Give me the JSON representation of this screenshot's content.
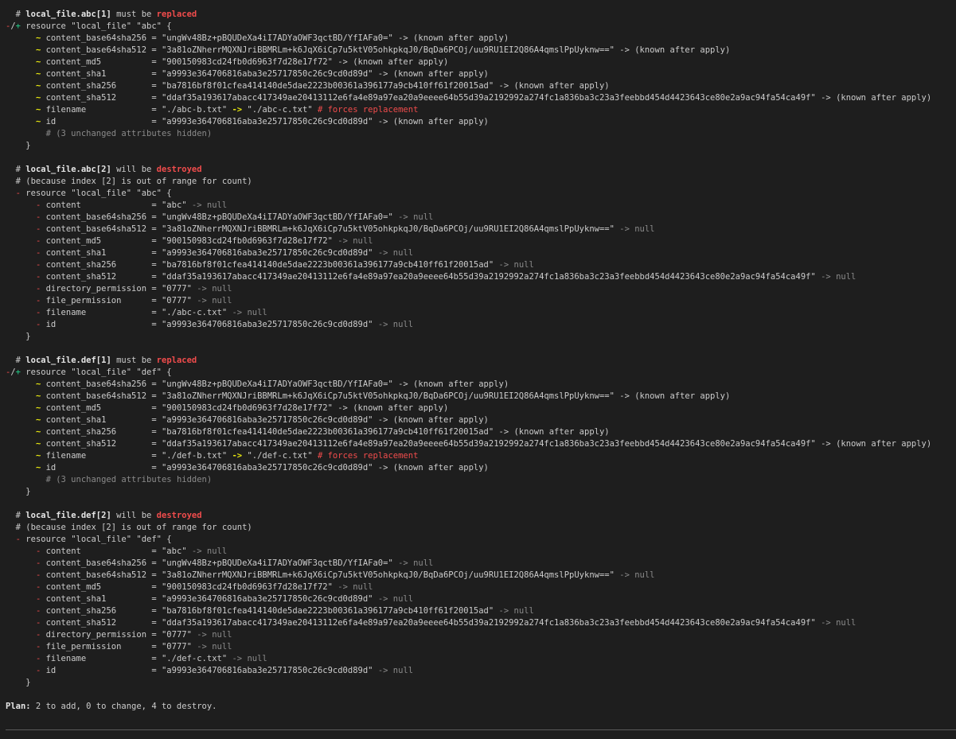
{
  "colors": {
    "background": "#1e1e1e",
    "text": "#cccccc",
    "red": "#f14c4c",
    "yellow": "#e5e510",
    "green": "#23d18b",
    "dim": "#8a8a8a"
  },
  "lines": [
    [
      {
        "t": "  # "
      },
      {
        "t": "local_file.abc[1]",
        "c": "b"
      },
      {
        "t": " must be "
      },
      {
        "t": "replaced",
        "c": "red"
      }
    ],
    [
      {
        "t": "-",
        "c": "red-plain"
      },
      {
        "t": "/",
        "c": ""
      },
      {
        "t": "+",
        "c": "grn"
      },
      {
        "t": " resource \"local_file\" \"abc\" {"
      }
    ],
    [
      {
        "t": "      "
      },
      {
        "t": "~",
        "c": "yel"
      },
      {
        "t": " content_base64sha256 = \"ungWv48Bz+pBQUDeXa4iI7ADYaOWF3qctBD/YfIAFa0=\" -> (known after apply)"
      }
    ],
    [
      {
        "t": "      "
      },
      {
        "t": "~",
        "c": "yel"
      },
      {
        "t": " content_base64sha512 = \"3a81oZNherrMQXNJriBBMRLm+k6JqX6iCp7u5ktV05ohkpkqJ0/BqDa6PCOj/uu9RU1EI2Q86A4qmslPpUyknw==\" -> (known after apply)"
      }
    ],
    [
      {
        "t": "      "
      },
      {
        "t": "~",
        "c": "yel"
      },
      {
        "t": " content_md5          = \"900150983cd24fb0d6963f7d28e17f72\" -> (known after apply)"
      }
    ],
    [
      {
        "t": "      "
      },
      {
        "t": "~",
        "c": "yel"
      },
      {
        "t": " content_sha1         = \"a9993e364706816aba3e25717850c26c9cd0d89d\" -> (known after apply)"
      }
    ],
    [
      {
        "t": "      "
      },
      {
        "t": "~",
        "c": "yel"
      },
      {
        "t": " content_sha256       = \"ba7816bf8f01cfea414140de5dae2223b00361a396177a9cb410ff61f20015ad\" -> (known after apply)"
      }
    ],
    [
      {
        "t": "      "
      },
      {
        "t": "~",
        "c": "yel"
      },
      {
        "t": " content_sha512       = \"ddaf35a193617abacc417349ae20413112e6fa4e89a97ea20a9eeee64b55d39a2192992a274fc1a836ba3c23a3feebbd454d4423643ce80e2a9ac94fa54ca49f\" -> (known after apply)"
      }
    ],
    [
      {
        "t": "      "
      },
      {
        "t": "~",
        "c": "yel"
      },
      {
        "t": " filename             = \"./abc-b.txt\" "
      },
      {
        "t": "->",
        "c": "yel"
      },
      {
        "t": " \"./abc-c.txt\" "
      },
      {
        "t": "# forces replacement",
        "c": "red-plain"
      }
    ],
    [
      {
        "t": "      "
      },
      {
        "t": "~",
        "c": "yel"
      },
      {
        "t": " id                   = \"a9993e364706816aba3e25717850c26c9cd0d89d\" -> (known after apply)"
      }
    ],
    [
      {
        "t": "        "
      },
      {
        "t": "# (3 unchanged attributes hidden)",
        "c": "dim"
      }
    ],
    [
      {
        "t": "    }"
      }
    ],
    [
      {
        "t": ""
      }
    ],
    [
      {
        "t": "  # "
      },
      {
        "t": "local_file.abc[2]",
        "c": "b"
      },
      {
        "t": " will be "
      },
      {
        "t": "destroyed",
        "c": "red"
      }
    ],
    [
      {
        "t": "  # (because index [2] is out of range for count)"
      }
    ],
    [
      {
        "t": "  "
      },
      {
        "t": "-",
        "c": "red-plain"
      },
      {
        "t": " resource \"local_file\" \"abc\" {"
      }
    ],
    [
      {
        "t": "      "
      },
      {
        "t": "-",
        "c": "red-plain"
      },
      {
        "t": " content              = \"abc\" "
      },
      {
        "t": "-> null",
        "c": "dim"
      }
    ],
    [
      {
        "t": "      "
      },
      {
        "t": "-",
        "c": "red-plain"
      },
      {
        "t": " content_base64sha256 = \"ungWv48Bz+pBQUDeXa4iI7ADYaOWF3qctBD/YfIAFa0=\" "
      },
      {
        "t": "-> null",
        "c": "dim"
      }
    ],
    [
      {
        "t": "      "
      },
      {
        "t": "-",
        "c": "red-plain"
      },
      {
        "t": " content_base64sha512 = \"3a81oZNherrMQXNJriBBMRLm+k6JqX6iCp7u5ktV05ohkpkqJ0/BqDa6PCOj/uu9RU1EI2Q86A4qmslPpUyknw==\" "
      },
      {
        "t": "-> null",
        "c": "dim"
      }
    ],
    [
      {
        "t": "      "
      },
      {
        "t": "-",
        "c": "red-plain"
      },
      {
        "t": " content_md5          = \"900150983cd24fb0d6963f7d28e17f72\" "
      },
      {
        "t": "-> null",
        "c": "dim"
      }
    ],
    [
      {
        "t": "      "
      },
      {
        "t": "-",
        "c": "red-plain"
      },
      {
        "t": " content_sha1         = \"a9993e364706816aba3e25717850c26c9cd0d89d\" "
      },
      {
        "t": "-> null",
        "c": "dim"
      }
    ],
    [
      {
        "t": "      "
      },
      {
        "t": "-",
        "c": "red-plain"
      },
      {
        "t": " content_sha256       = \"ba7816bf8f01cfea414140de5dae2223b00361a396177a9cb410ff61f20015ad\" "
      },
      {
        "t": "-> null",
        "c": "dim"
      }
    ],
    [
      {
        "t": "      "
      },
      {
        "t": "-",
        "c": "red-plain"
      },
      {
        "t": " content_sha512       = \"ddaf35a193617abacc417349ae20413112e6fa4e89a97ea20a9eeee64b55d39a2192992a274fc1a836ba3c23a3feebbd454d4423643ce80e2a9ac94fa54ca49f\" "
      },
      {
        "t": "-> null",
        "c": "dim"
      }
    ],
    [
      {
        "t": "      "
      },
      {
        "t": "-",
        "c": "red-plain"
      },
      {
        "t": " directory_permission = \"0777\" "
      },
      {
        "t": "-> null",
        "c": "dim"
      }
    ],
    [
      {
        "t": "      "
      },
      {
        "t": "-",
        "c": "red-plain"
      },
      {
        "t": " file_permission      = \"0777\" "
      },
      {
        "t": "-> null",
        "c": "dim"
      }
    ],
    [
      {
        "t": "      "
      },
      {
        "t": "-",
        "c": "red-plain"
      },
      {
        "t": " filename             = \"./abc-c.txt\" "
      },
      {
        "t": "-> null",
        "c": "dim"
      }
    ],
    [
      {
        "t": "      "
      },
      {
        "t": "-",
        "c": "red-plain"
      },
      {
        "t": " id                   = \"a9993e364706816aba3e25717850c26c9cd0d89d\" "
      },
      {
        "t": "-> null",
        "c": "dim"
      }
    ],
    [
      {
        "t": "    }"
      }
    ],
    [
      {
        "t": ""
      }
    ],
    [
      {
        "t": "  # "
      },
      {
        "t": "local_file.def[1]",
        "c": "b"
      },
      {
        "t": " must be "
      },
      {
        "t": "replaced",
        "c": "red"
      }
    ],
    [
      {
        "t": "-",
        "c": "red-plain"
      },
      {
        "t": "/",
        "c": ""
      },
      {
        "t": "+",
        "c": "grn"
      },
      {
        "t": " resource \"local_file\" \"def\" {"
      }
    ],
    [
      {
        "t": "      "
      },
      {
        "t": "~",
        "c": "yel"
      },
      {
        "t": " content_base64sha256 = \"ungWv48Bz+pBQUDeXa4iI7ADYaOWF3qctBD/YfIAFa0=\" -> (known after apply)"
      }
    ],
    [
      {
        "t": "      "
      },
      {
        "t": "~",
        "c": "yel"
      },
      {
        "t": " content_base64sha512 = \"3a81oZNherrMQXNJriBBMRLm+k6JqX6iCp7u5ktV05ohkpkqJ0/BqDa6PCOj/uu9RU1EI2Q86A4qmslPpUyknw==\" -> (known after apply)"
      }
    ],
    [
      {
        "t": "      "
      },
      {
        "t": "~",
        "c": "yel"
      },
      {
        "t": " content_md5          = \"900150983cd24fb0d6963f7d28e17f72\" -> (known after apply)"
      }
    ],
    [
      {
        "t": "      "
      },
      {
        "t": "~",
        "c": "yel"
      },
      {
        "t": " content_sha1         = \"a9993e364706816aba3e25717850c26c9cd0d89d\" -> (known after apply)"
      }
    ],
    [
      {
        "t": "      "
      },
      {
        "t": "~",
        "c": "yel"
      },
      {
        "t": " content_sha256       = \"ba7816bf8f01cfea414140de5dae2223b00361a396177a9cb410ff61f20015ad\" -> (known after apply)"
      }
    ],
    [
      {
        "t": "      "
      },
      {
        "t": "~",
        "c": "yel"
      },
      {
        "t": " content_sha512       = \"ddaf35a193617abacc417349ae20413112e6fa4e89a97ea20a9eeee64b55d39a2192992a274fc1a836ba3c23a3feebbd454d4423643ce80e2a9ac94fa54ca49f\" -> (known after apply)"
      }
    ],
    [
      {
        "t": "      "
      },
      {
        "t": "~",
        "c": "yel"
      },
      {
        "t": " filename             = \"./def-b.txt\" "
      },
      {
        "t": "->",
        "c": "yel"
      },
      {
        "t": " \"./def-c.txt\" "
      },
      {
        "t": "# forces replacement",
        "c": "red-plain"
      }
    ],
    [
      {
        "t": "      "
      },
      {
        "t": "~",
        "c": "yel"
      },
      {
        "t": " id                   = \"a9993e364706816aba3e25717850c26c9cd0d89d\" -> (known after apply)"
      }
    ],
    [
      {
        "t": "        "
      },
      {
        "t": "# (3 unchanged attributes hidden)",
        "c": "dim"
      }
    ],
    [
      {
        "t": "    }"
      }
    ],
    [
      {
        "t": ""
      }
    ],
    [
      {
        "t": "  # "
      },
      {
        "t": "local_file.def[2]",
        "c": "b"
      },
      {
        "t": " will be "
      },
      {
        "t": "destroyed",
        "c": "red"
      }
    ],
    [
      {
        "t": "  # (because index [2] is out of range for count)"
      }
    ],
    [
      {
        "t": "  "
      },
      {
        "t": "-",
        "c": "red-plain"
      },
      {
        "t": " resource \"local_file\" \"def\" {"
      }
    ],
    [
      {
        "t": "      "
      },
      {
        "t": "-",
        "c": "red-plain"
      },
      {
        "t": " content              = \"abc\" "
      },
      {
        "t": "-> null",
        "c": "dim"
      }
    ],
    [
      {
        "t": "      "
      },
      {
        "t": "-",
        "c": "red-plain"
      },
      {
        "t": " content_base64sha256 = \"ungWv48Bz+pBQUDeXa4iI7ADYaOWF3qctBD/YfIAFa0=\" "
      },
      {
        "t": "-> null",
        "c": "dim"
      }
    ],
    [
      {
        "t": "      "
      },
      {
        "t": "-",
        "c": "red-plain"
      },
      {
        "t": " content_base64sha512 = \"3a81oZNherrMQXNJriBBMRLm+k6JqX6iCp7u5ktV05ohkpkqJ0/BqDa6PCOj/uu9RU1EI2Q86A4qmslPpUyknw==\" "
      },
      {
        "t": "-> null",
        "c": "dim"
      }
    ],
    [
      {
        "t": "      "
      },
      {
        "t": "-",
        "c": "red-plain"
      },
      {
        "t": " content_md5          = \"900150983cd24fb0d6963f7d28e17f72\" "
      },
      {
        "t": "-> null",
        "c": "dim"
      }
    ],
    [
      {
        "t": "      "
      },
      {
        "t": "-",
        "c": "red-plain"
      },
      {
        "t": " content_sha1         = \"a9993e364706816aba3e25717850c26c9cd0d89d\" "
      },
      {
        "t": "-> null",
        "c": "dim"
      }
    ],
    [
      {
        "t": "      "
      },
      {
        "t": "-",
        "c": "red-plain"
      },
      {
        "t": " content_sha256       = \"ba7816bf8f01cfea414140de5dae2223b00361a396177a9cb410ff61f20015ad\" "
      },
      {
        "t": "-> null",
        "c": "dim"
      }
    ],
    [
      {
        "t": "      "
      },
      {
        "t": "-",
        "c": "red-plain"
      },
      {
        "t": " content_sha512       = \"ddaf35a193617abacc417349ae20413112e6fa4e89a97ea20a9eeee64b55d39a2192992a274fc1a836ba3c23a3feebbd454d4423643ce80e2a9ac94fa54ca49f\" "
      },
      {
        "t": "-> null",
        "c": "dim"
      }
    ],
    [
      {
        "t": "      "
      },
      {
        "t": "-",
        "c": "red-plain"
      },
      {
        "t": " directory_permission = \"0777\" "
      },
      {
        "t": "-> null",
        "c": "dim"
      }
    ],
    [
      {
        "t": "      "
      },
      {
        "t": "-",
        "c": "red-plain"
      },
      {
        "t": " file_permission      = \"0777\" "
      },
      {
        "t": "-> null",
        "c": "dim"
      }
    ],
    [
      {
        "t": "      "
      },
      {
        "t": "-",
        "c": "red-plain"
      },
      {
        "t": " filename             = \"./def-c.txt\" "
      },
      {
        "t": "-> null",
        "c": "dim"
      }
    ],
    [
      {
        "t": "      "
      },
      {
        "t": "-",
        "c": "red-plain"
      },
      {
        "t": " id                   = \"a9993e364706816aba3e25717850c26c9cd0d89d\" "
      },
      {
        "t": "-> null",
        "c": "dim"
      }
    ],
    [
      {
        "t": "    }"
      }
    ],
    [
      {
        "t": ""
      }
    ],
    [
      {
        "t": "Plan:",
        "c": "b"
      },
      {
        "t": " 2 to add, 0 to change, 4 to destroy."
      }
    ]
  ]
}
